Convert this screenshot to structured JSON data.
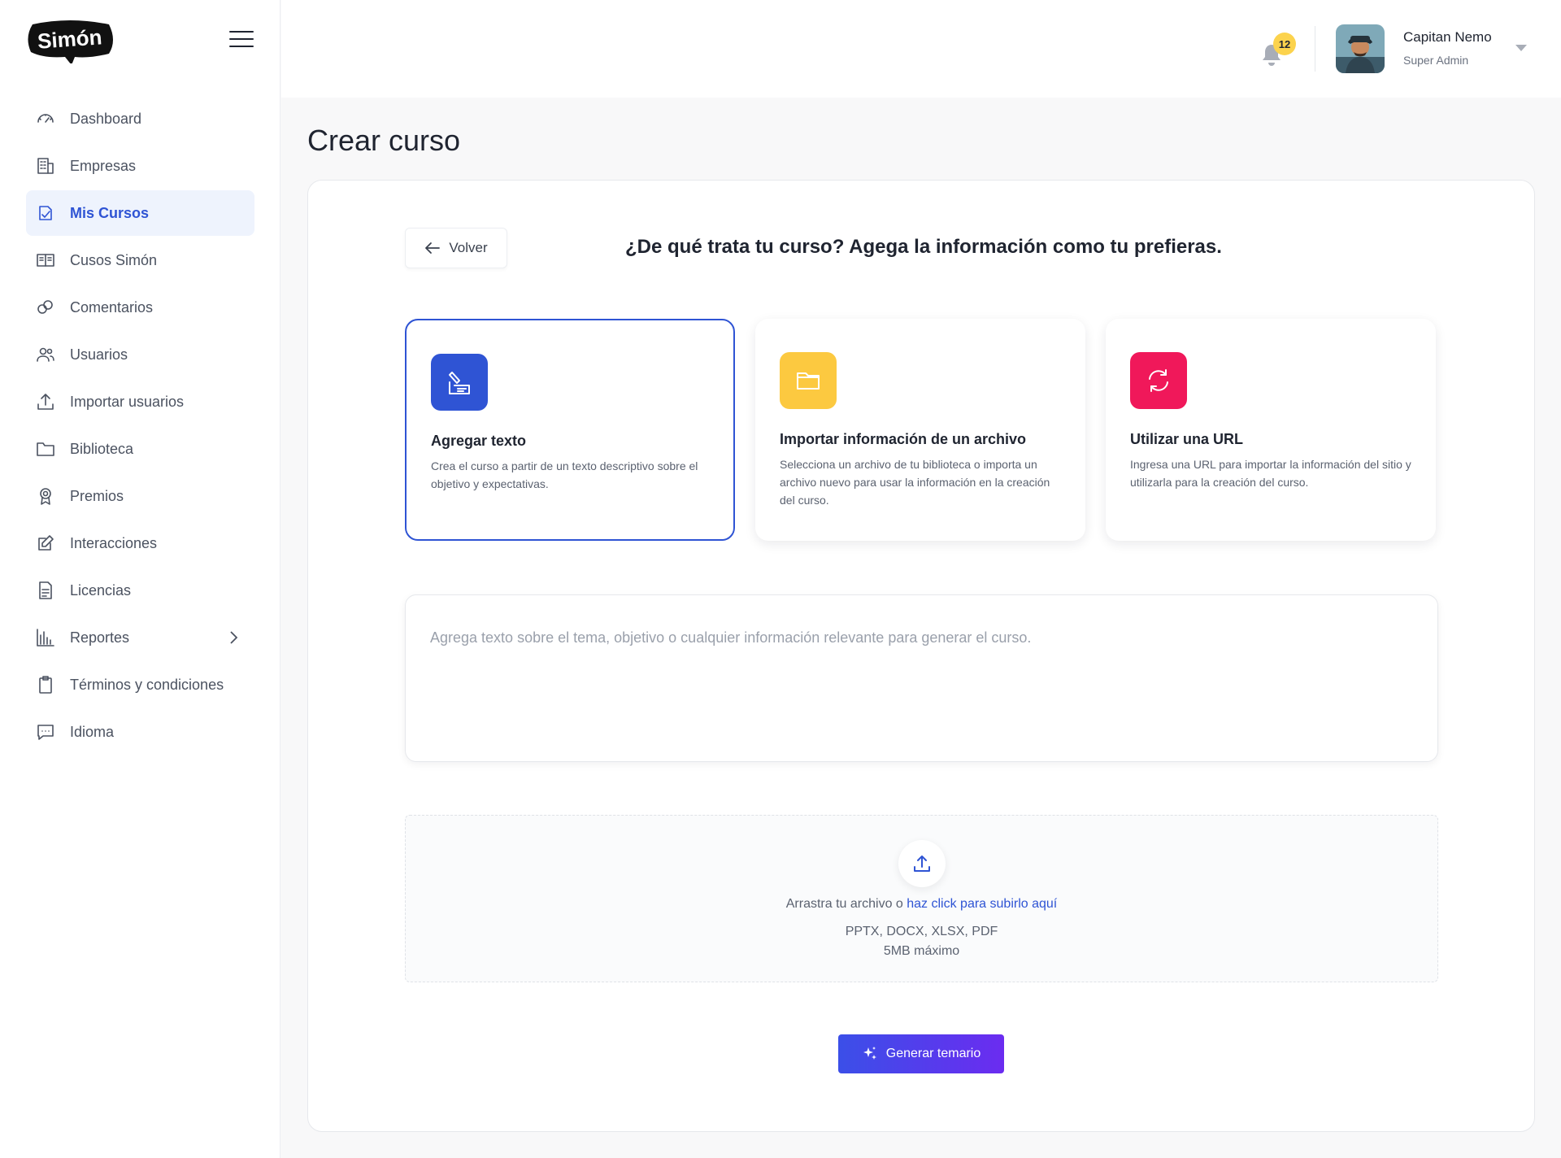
{
  "brand": {
    "logo_text": "Simón"
  },
  "sidebar": {
    "items": [
      {
        "label": "Dashboard",
        "icon": "gauge-icon"
      },
      {
        "label": "Empresas",
        "icon": "building-icon"
      },
      {
        "label": "Mis Cursos",
        "icon": "course-icon",
        "active": true
      },
      {
        "label": "Cusos Simón",
        "icon": "book-icon"
      },
      {
        "label": "Comentarios",
        "icon": "comments-icon"
      },
      {
        "label": "Usuarios",
        "icon": "users-icon"
      },
      {
        "label": "Importar usuarios",
        "icon": "upload-icon"
      },
      {
        "label": "Biblioteca",
        "icon": "folder-icon"
      },
      {
        "label": "Premios",
        "icon": "award-icon"
      },
      {
        "label": "Interacciones",
        "icon": "edit-icon"
      },
      {
        "label": "Licencias",
        "icon": "document-icon"
      },
      {
        "label": "Reportes",
        "icon": "chart-icon",
        "has_submenu": true
      },
      {
        "label": "Términos y condiciones",
        "icon": "clipboard-icon"
      },
      {
        "label": "Idioma",
        "icon": "chat-icon"
      }
    ]
  },
  "header": {
    "notifications_count": "12",
    "user_name": "Capitan Nemo",
    "user_role": "Super Admin"
  },
  "page": {
    "title": "Crear curso",
    "back_label": "Volver",
    "question": "¿De qué trata tu curso? Agega la información como tu prefieras."
  },
  "options": [
    {
      "title": "Agregar texto",
      "description": "Crea el curso a partir de un texto descriptivo sobre el objetivo y expectativas.",
      "color": "#2f54d4",
      "icon": "write-icon",
      "selected": true
    },
    {
      "title": "Importar información de un archivo",
      "description": "Selecciona un archivo de tu biblioteca o importa un archivo nuevo para usar la información en la creación del curso.",
      "color": "#fcc940",
      "icon": "folder-icon",
      "selected": false
    },
    {
      "title": "Utilizar una URL",
      "description": "Ingresa una URL para importar la información del sitio y utilizarla para la creación del curso.",
      "color": "#f0185a",
      "icon": "refresh-icon",
      "selected": false
    }
  ],
  "textarea": {
    "placeholder": "Agrega texto sobre el tema, objetivo o cualquier información relevante para generar el curso.",
    "value": ""
  },
  "dropzone": {
    "prefix": "Arrastra tu archivo o ",
    "link": "haz click para subirlo aquí",
    "types": "PPTX, DOCX, XLSX, PDF",
    "max_size": "5MB máximo"
  },
  "generate_label": "Generar temario",
  "colors": {
    "accent": "#2f54d4",
    "badge": "#fcd34d"
  }
}
